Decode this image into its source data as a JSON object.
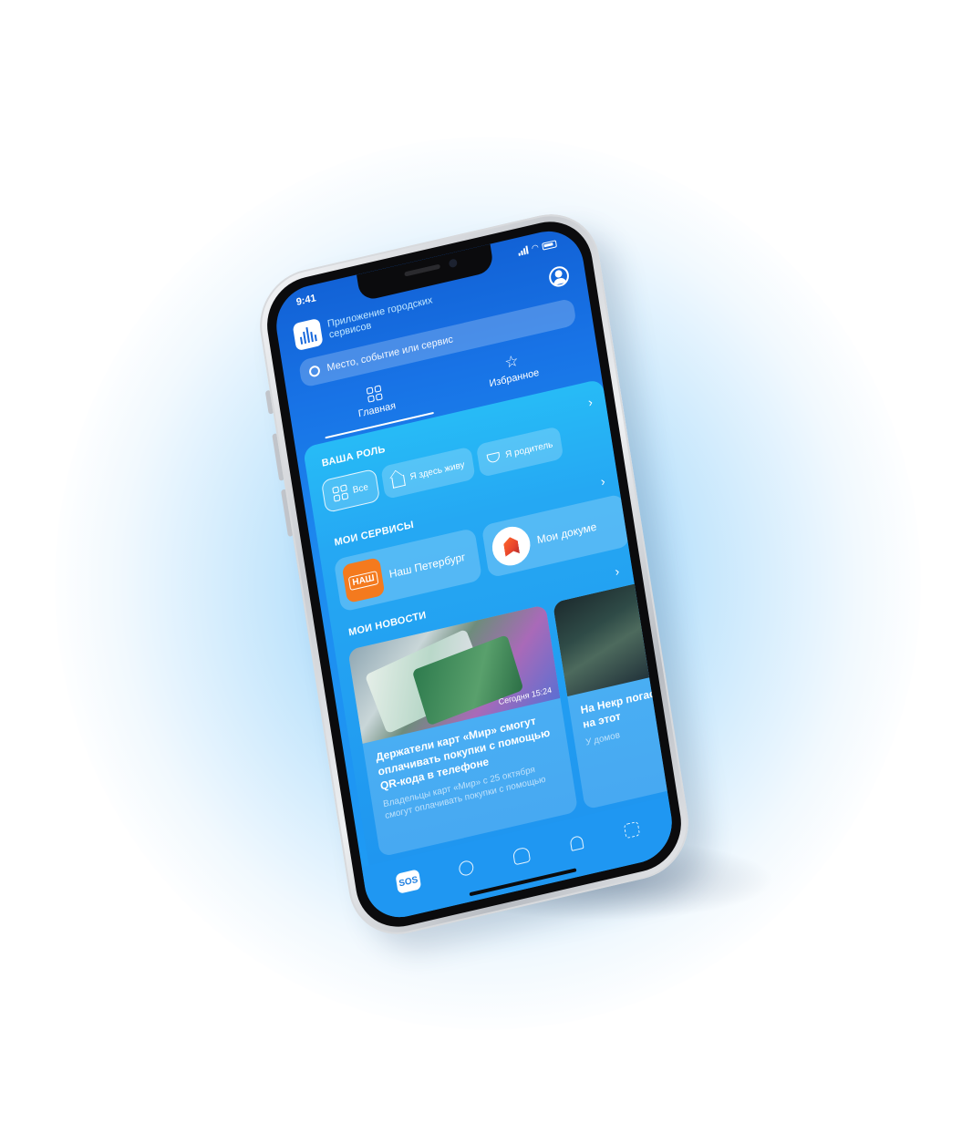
{
  "status": {
    "time": "9:41"
  },
  "header": {
    "app_title": "Приложение городских сервисов"
  },
  "search": {
    "placeholder": "Место, событие или сервис"
  },
  "tabs": [
    {
      "label": "Главная",
      "icon": "grid-icon",
      "active": true
    },
    {
      "label": "Избранное",
      "icon": "star-icon",
      "active": false
    }
  ],
  "roles": {
    "title": "ВАША РОЛЬ",
    "items": [
      {
        "label": "Все",
        "icon": "grid-icon",
        "selected": true
      },
      {
        "label": "Я здесь живу",
        "icon": "house-icon",
        "selected": false
      },
      {
        "label": "Я родитель",
        "icon": "stroller-icon",
        "selected": false
      }
    ]
  },
  "services": {
    "title": "МОИ СЕРВИСЫ",
    "items": [
      {
        "label": "Наш Петербург",
        "logo_text": "НАШ"
      },
      {
        "label": "Мои докуме"
      }
    ]
  },
  "news": {
    "title": "МОИ НОВОСТИ",
    "items": [
      {
        "time": "Сегодня 15:24",
        "title": "Держатели карт «Мир» смогут оплачивать покупки с помощью QR-кода в телефоне",
        "excerpt": "Владельцы карт «Мир» с 25 октября смогут оплачивать покупки с помощью"
      },
      {
        "title": "На Некр погасш на этот",
        "excerpt": "У домов"
      }
    ]
  },
  "bottom_nav": {
    "sos_label": "SOS"
  },
  "colors": {
    "screen_top": "#1262d6",
    "screen_bottom": "#1e9df5",
    "panel": "#25a8f3",
    "nash_orange": "#f47a1e",
    "glow": "#69befa"
  }
}
